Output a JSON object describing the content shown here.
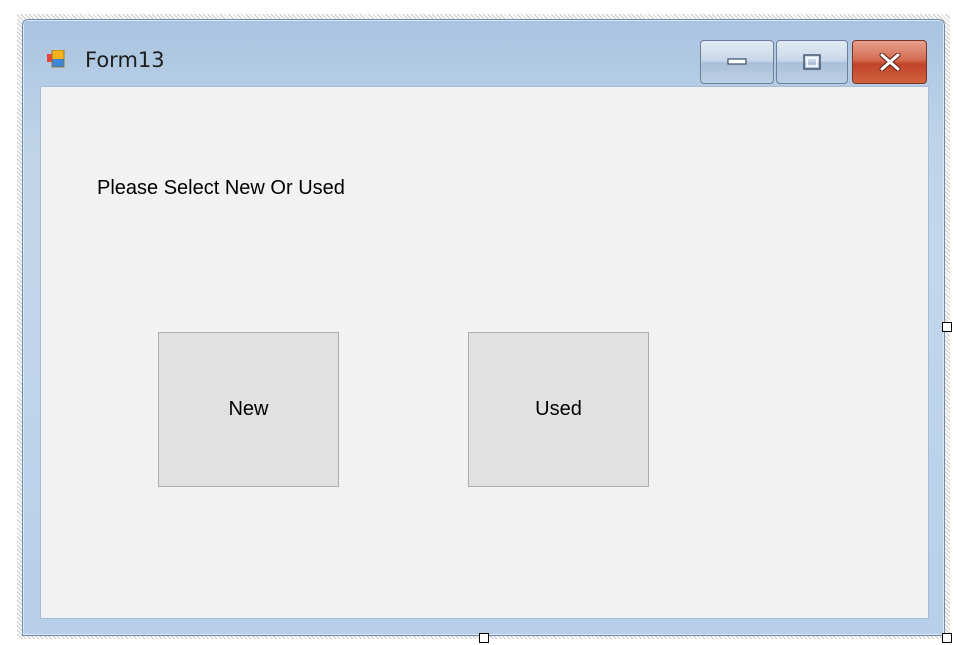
{
  "window": {
    "title": "Form13",
    "icon": "winforms-app-icon",
    "caption_buttons": [
      "minimize-icon",
      "maximize-icon",
      "close-icon"
    ]
  },
  "form": {
    "prompt": "Please Select New Or Used",
    "buttons": {
      "new_label": "New",
      "used_label": "Used"
    }
  },
  "designer": {
    "handles": [
      "right-middle-handle",
      "bottom-middle-handle",
      "bottom-right-handle"
    ]
  },
  "colors": {
    "client_background": "#f2f2f2",
    "button_face": "#e1e1e1",
    "window_frame": "#bed3e8",
    "close_button": "#c7462b"
  }
}
